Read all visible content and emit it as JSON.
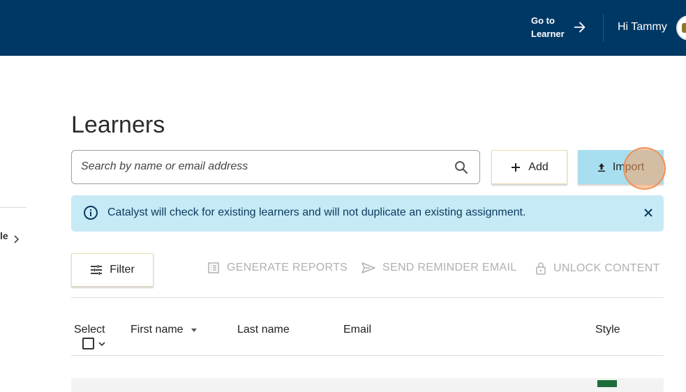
{
  "header": {
    "go_to_learner_line1": "Go to",
    "go_to_learner_line2": "Learner",
    "greeting": "Hi Tammy"
  },
  "sidebar": {
    "partial_item_label": "le"
  },
  "page": {
    "title": "Learners"
  },
  "search": {
    "placeholder": "Search by name or email address",
    "value": ""
  },
  "buttons": {
    "add_label": "Add",
    "import_label": "Import",
    "filter_label": "Filter"
  },
  "alert": {
    "message": "Catalyst will check for existing learners and will not duplicate an existing assignment."
  },
  "actions": {
    "generate_reports": "GENERATE REPORTS",
    "send_reminder_email": "SEND REMINDER EMAIL",
    "unlock_content": "UNLOCK CONTENT"
  },
  "table": {
    "columns": {
      "select": "Select",
      "first_name": "First name",
      "last_name": "Last name",
      "email": "Email",
      "style": "Style"
    }
  },
  "colors": {
    "header_bg": "#003865",
    "alert_bg": "#c6eaf6",
    "import_bg": "#a8dff0",
    "disabled_text": "#b0b0b0"
  }
}
